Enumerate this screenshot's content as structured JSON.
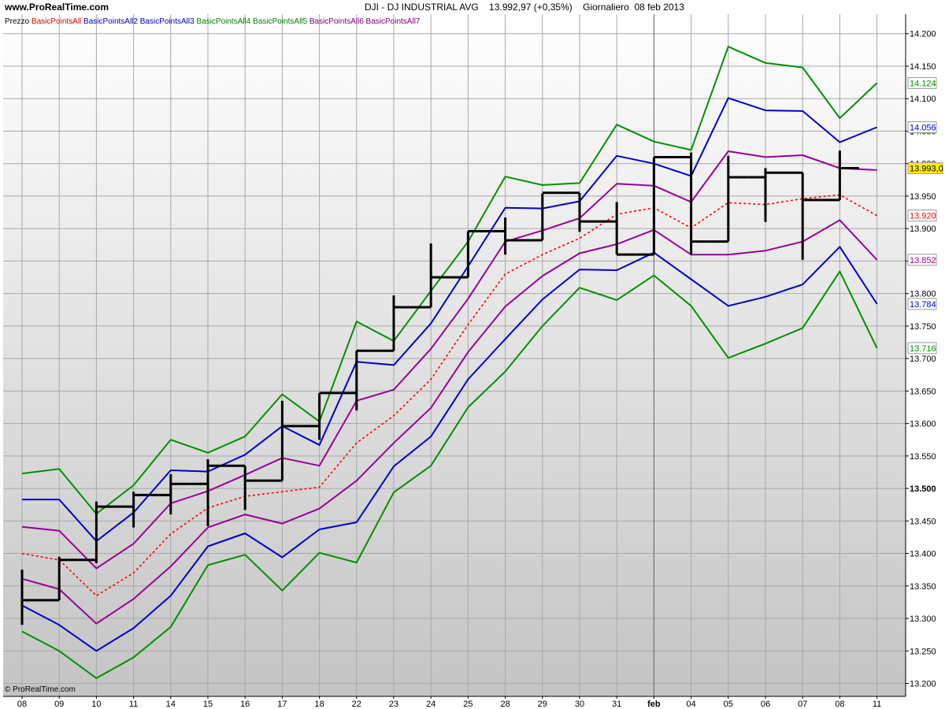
{
  "header": {
    "site": "www.ProRealTime.com",
    "symbol": "DJI - DJ INDUSTRIAL AVG",
    "price_change": "13.992,97 (+0,35%)",
    "period_date": "Giornaliero  08 feb 2013"
  },
  "legend": {
    "price_label": "Prezzo",
    "items": [
      {
        "label": "BasicPointsAll",
        "color": "#e00000"
      },
      {
        "label": "BasicPointsAll2",
        "color": "#0000c0"
      },
      {
        "label": "BasicPointsAll3",
        "color": "#0000c0"
      },
      {
        "label": "BasicPointsAll4",
        "color": "#008000"
      },
      {
        "label": "BasicPointsAll5",
        "color": "#008000"
      },
      {
        "label": "BasicPointsAll6",
        "color": "#800080"
      },
      {
        "label": "BasicPointsAll7",
        "color": "#800080"
      }
    ]
  },
  "copyright": "© ProRealTime.com",
  "chart_data": {
    "type": "line",
    "background_gradient": [
      "#ffffff",
      "#c4c4c4"
    ],
    "grid": true,
    "ylim": [
      13180,
      14230
    ],
    "y_ticks": [
      13200,
      13250,
      13300,
      13350,
      13400,
      13450,
      13500,
      13550,
      13600,
      13650,
      13700,
      13750,
      13800,
      13850,
      13900,
      13950,
      14000,
      14050,
      14100,
      14150,
      14200
    ],
    "y_tick_labels": [
      "13.200",
      "13.250",
      "13.300",
      "13.350",
      "13.400",
      "13.450",
      "13.500",
      "13.550",
      "13.600",
      "13.650",
      "13.700",
      "13.750",
      "13.800",
      "13.850",
      "13.900",
      "13.950",
      "14.000",
      "14.050",
      "14.100",
      "14.150",
      "14.200"
    ],
    "y_bold_tick": "13.500",
    "x_tick_labels": [
      "08",
      "09",
      "10",
      "11",
      "14",
      "15",
      "16",
      "17",
      "18",
      "22",
      "23",
      "24",
      "25",
      "28",
      "29",
      "30",
      "31",
      "feb",
      "04",
      "05",
      "06",
      "07",
      "08",
      "11"
    ],
    "x_bold_label": "feb",
    "month_separator_index": 17,
    "price_bars": [
      {
        "o": 13375,
        "h": 13375,
        "l": 13290,
        "c": 13328
      },
      {
        "o": 13328,
        "h": 13395,
        "l": 13328,
        "c": 13390
      },
      {
        "o": 13390,
        "h": 13480,
        "l": 13385,
        "c": 13472
      },
      {
        "o": 13472,
        "h": 13495,
        "l": 13440,
        "c": 13490
      },
      {
        "o": 13490,
        "h": 13522,
        "l": 13460,
        "c": 13507
      },
      {
        "o": 13507,
        "h": 13545,
        "l": 13442,
        "c": 13535
      },
      {
        "o": 13535,
        "h": 13535,
        "l": 13467,
        "c": 13512
      },
      {
        "o": 13512,
        "h": 13635,
        "l": 13512,
        "c": 13596
      },
      {
        "o": 13596,
        "h": 13647,
        "l": 13575,
        "c": 13647
      },
      {
        "o": 13647,
        "h": 13712,
        "l": 13620,
        "c": 13712
      },
      {
        "o": 13712,
        "h": 13797,
        "l": 13712,
        "c": 13779
      },
      {
        "o": 13779,
        "h": 13877,
        "l": 13779,
        "c": 13825
      },
      {
        "o": 13825,
        "h": 13896,
        "l": 13825,
        "c": 13896
      },
      {
        "o": 13896,
        "h": 13917,
        "l": 13860,
        "c": 13882
      },
      {
        "o": 13882,
        "h": 13954,
        "l": 13882,
        "c": 13955
      },
      {
        "o": 13955,
        "h": 13955,
        "l": 13895,
        "c": 13911
      },
      {
        "o": 13911,
        "h": 13941,
        "l": 13860,
        "c": 13860
      },
      {
        "o": 13860,
        "h": 14010,
        "l": 13860,
        "c": 14010
      },
      {
        "o": 14010,
        "h": 14017,
        "l": 13860,
        "c": 13880
      },
      {
        "o": 13880,
        "h": 14012,
        "l": 13880,
        "c": 13979
      },
      {
        "o": 13979,
        "h": 13993,
        "l": 13910,
        "c": 13986
      },
      {
        "o": 13986,
        "h": 13986,
        "l": 13852,
        "c": 13944
      },
      {
        "o": 13944,
        "h": 14020,
        "l": 13944,
        "c": 13993
      }
    ],
    "series": [
      {
        "name": "BasicPointsAll",
        "color": "#ff0000",
        "dashed": true,
        "values": [
          13400,
          13390,
          13335,
          13370,
          13430,
          13470,
          13488,
          13495,
          13502,
          13570,
          13612,
          13668,
          13752,
          13830,
          13860,
          13885,
          13922,
          13932,
          13901,
          13940,
          13937,
          13946,
          13952,
          13920
        ]
      },
      {
        "name": "BasicPointsAll2",
        "color": "#0000cc",
        "values": [
          13483,
          13483,
          13419,
          13463,
          13528,
          13526,
          13552,
          13596,
          13567,
          13695,
          13690,
          13754,
          13842,
          13932,
          13931,
          13942,
          14012,
          14000,
          13981,
          14101,
          14082,
          14081,
          14033,
          14056
        ]
      },
      {
        "name": "BasicPointsAll3",
        "color": "#0000cc",
        "values": [
          13320,
          13290,
          13250,
          13285,
          13335,
          13411,
          13431,
          13394,
          13437,
          13448,
          13534,
          13580,
          13668,
          13730,
          13791,
          13837,
          13836,
          13863,
          13822,
          13781,
          13795,
          13814,
          13872,
          13784
        ]
      },
      {
        "name": "BasicPointsAll4",
        "color": "#009000",
        "values": [
          13523,
          13530,
          13461,
          13505,
          13575,
          13555,
          13580,
          13645,
          13603,
          13757,
          13727,
          13804,
          13880,
          13980,
          13967,
          13970,
          14060,
          14034,
          14021,
          14180,
          14155,
          14148,
          14070,
          14124
        ]
      },
      {
        "name": "BasicPointsAll5",
        "color": "#009000",
        "values": [
          13280,
          13250,
          13208,
          13240,
          13287,
          13382,
          13398,
          13343,
          13401,
          13386,
          13494,
          13535,
          13625,
          13680,
          13750,
          13809,
          13790,
          13828,
          13781,
          13701,
          13723,
          13747,
          13834,
          13716
        ]
      },
      {
        "name": "BasicPointsAll6",
        "color": "#990099",
        "values": [
          13441,
          13435,
          13377,
          13415,
          13477,
          13496,
          13521,
          13547,
          13535,
          13635,
          13652,
          13715,
          13792,
          13880,
          13897,
          13916,
          13969,
          13966,
          13941,
          14019,
          14010,
          14013,
          13993,
          13990
        ]
      },
      {
        "name": "BasicPointsAll7",
        "color": "#990099",
        "values": [
          13361,
          13345,
          13292,
          13330,
          13380,
          13440,
          13460,
          13446,
          13469,
          13512,
          13570,
          13624,
          13710,
          13780,
          13827,
          13862,
          13876,
          13898,
          13860,
          13860,
          13866,
          13880,
          13913,
          13852
        ]
      }
    ],
    "value_labels": [
      {
        "text": "14.124",
        "value": 14124,
        "color": "#009000",
        "bg": "#ffffff"
      },
      {
        "text": "14.056",
        "value": 14056,
        "color": "#0000cc",
        "bg": "#ffffff"
      },
      {
        "text": "13.993,0",
        "value": 13993,
        "color": "#000000",
        "bg": "#ffee00"
      },
      {
        "text": "13.920",
        "value": 13920,
        "color": "#ff0000",
        "bg": "#ffffff"
      },
      {
        "text": "13.852",
        "value": 13852,
        "color": "#990099",
        "bg": "#ffffff"
      },
      {
        "text": "13.784",
        "value": 13784,
        "color": "#0000cc",
        "bg": "#ffffff"
      },
      {
        "text": "13.716",
        "value": 13716,
        "color": "#009000",
        "bg": "#ffffff"
      }
    ]
  }
}
